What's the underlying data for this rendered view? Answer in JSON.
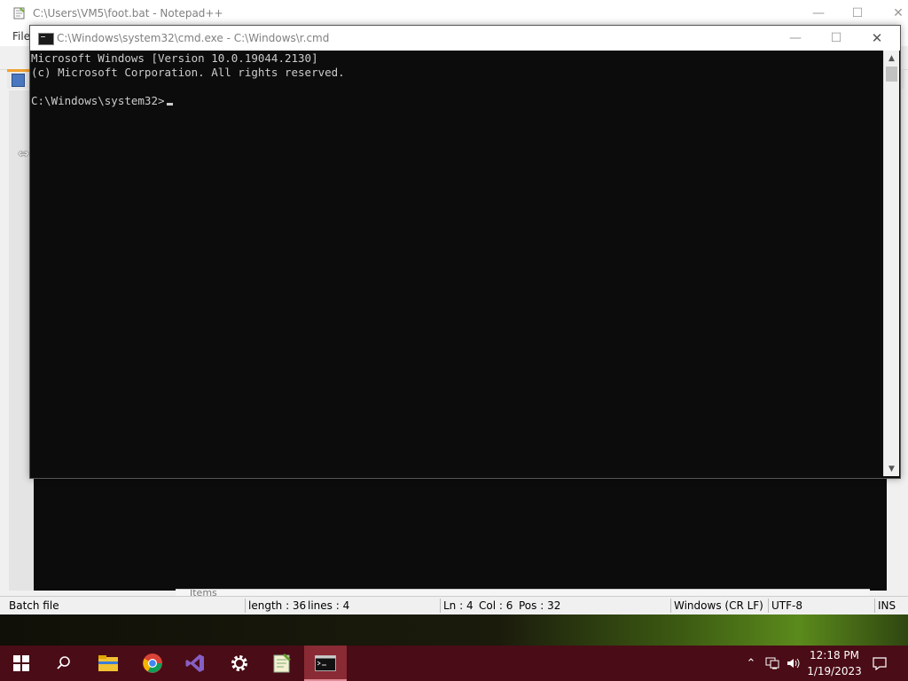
{
  "notepadpp": {
    "title": "C:\\Users\\VM5\\foot.bat - Notepad++",
    "menu_file": "File",
    "doclist_text": "Items",
    "status": {
      "type": "Batch file",
      "length": "length : 36",
      "lines": "lines : 4",
      "ln": "Ln : 4",
      "col": "Col : 6",
      "pos": "Pos : 32",
      "eol": "Windows (CR LF)",
      "encoding": "UTF-8",
      "mode": "INS"
    }
  },
  "cmd": {
    "title": "C:\\Windows\\system32\\cmd.exe - C:\\Windows\\r.cmd",
    "lines": [
      "Microsoft Windows [Version 10.0.19044.2130]",
      "(c) Microsoft Corporation. All rights reserved.",
      "",
      "C:\\Windows\\system32>"
    ]
  },
  "taskbar": {
    "apps": [
      {
        "name": "start-icon"
      },
      {
        "name": "search-icon"
      },
      {
        "name": "file-explorer-icon"
      },
      {
        "name": "chrome-icon"
      },
      {
        "name": "visual-studio-icon"
      },
      {
        "name": "settings-gear-icon"
      },
      {
        "name": "notepadpp-icon"
      },
      {
        "name": "cmd-icon",
        "active": true
      }
    ],
    "clock_time": "12:18 PM",
    "clock_date": "1/19/2023"
  },
  "colors": {
    "taskbar": "#4a0c16",
    "console_bg": "#0c0c0c",
    "console_text": "#cccccc"
  }
}
